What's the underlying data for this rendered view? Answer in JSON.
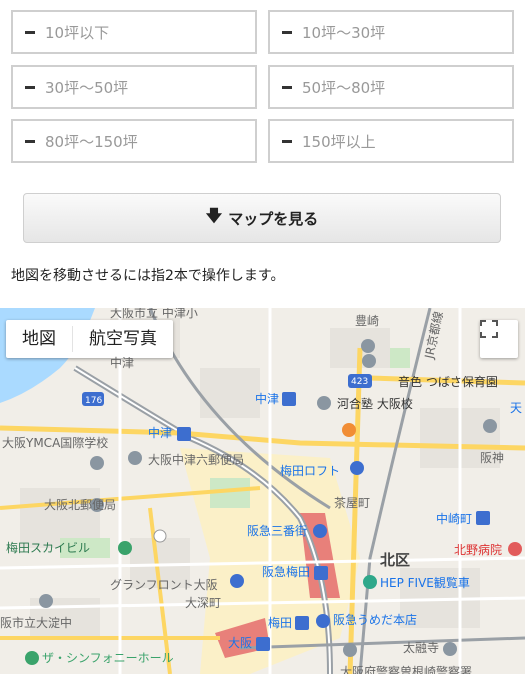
{
  "filters": [
    {
      "label": "10坪以下"
    },
    {
      "label": "10坪～30坪"
    },
    {
      "label": "30坪～50坪"
    },
    {
      "label": "50坪～80坪"
    },
    {
      "label": "80坪～150坪"
    },
    {
      "label": "150坪以上"
    }
  ],
  "map_button": {
    "icon": "arrow-down-icon",
    "label": "マップを見る"
  },
  "hint": "地図を移動させるには指2本で操作します。",
  "map": {
    "type_tabs": [
      "地図",
      "航空写真"
    ],
    "labels": {
      "umeda_sky": "梅田スカイビル",
      "umeda_loft": "梅田ロフト",
      "hankyu_sanbangai": "阪急三番街",
      "hankyu_umeda": "阪急梅田",
      "hep_five": "HEP FIVE観覧車",
      "kita_ku": "北区",
      "grand_front": "グランフロント大阪",
      "osaka_station": "大阪",
      "umeda": "梅田",
      "hankyu_umeda_main": "阪急うめだ本店",
      "kawaijuku": "河合塾 大阪校",
      "nakatsu_1": "中津",
      "nakatsu_2": "中津",
      "nakatsu_3": "中津",
      "ymca": "大阪YMCA国際学校",
      "post_office": "大阪中津六郵便局",
      "kita_post": "大阪北郵便局",
      "chayamachi": "茶屋町",
      "nakazakicho": "中崎町",
      "kitano_hospital": "北野病院",
      "daiyushi": "太融寺",
      "symphony": "ザ・シンフォニーホール",
      "tsubasa": "音色 つばさ保育園",
      "toyosaki": "豊崎",
      "ofukacho": "大深町",
      "oyodo_school": "大阪市立 中津小",
      "shiritsu": "阪市立大淀中",
      "jr": "JR京都線",
      "road_423": "423",
      "road_176": "176",
      "hanshin": "阪神",
      "ten": "天",
      "jpd": "大阪府警察曽根崎警察署"
    }
  }
}
